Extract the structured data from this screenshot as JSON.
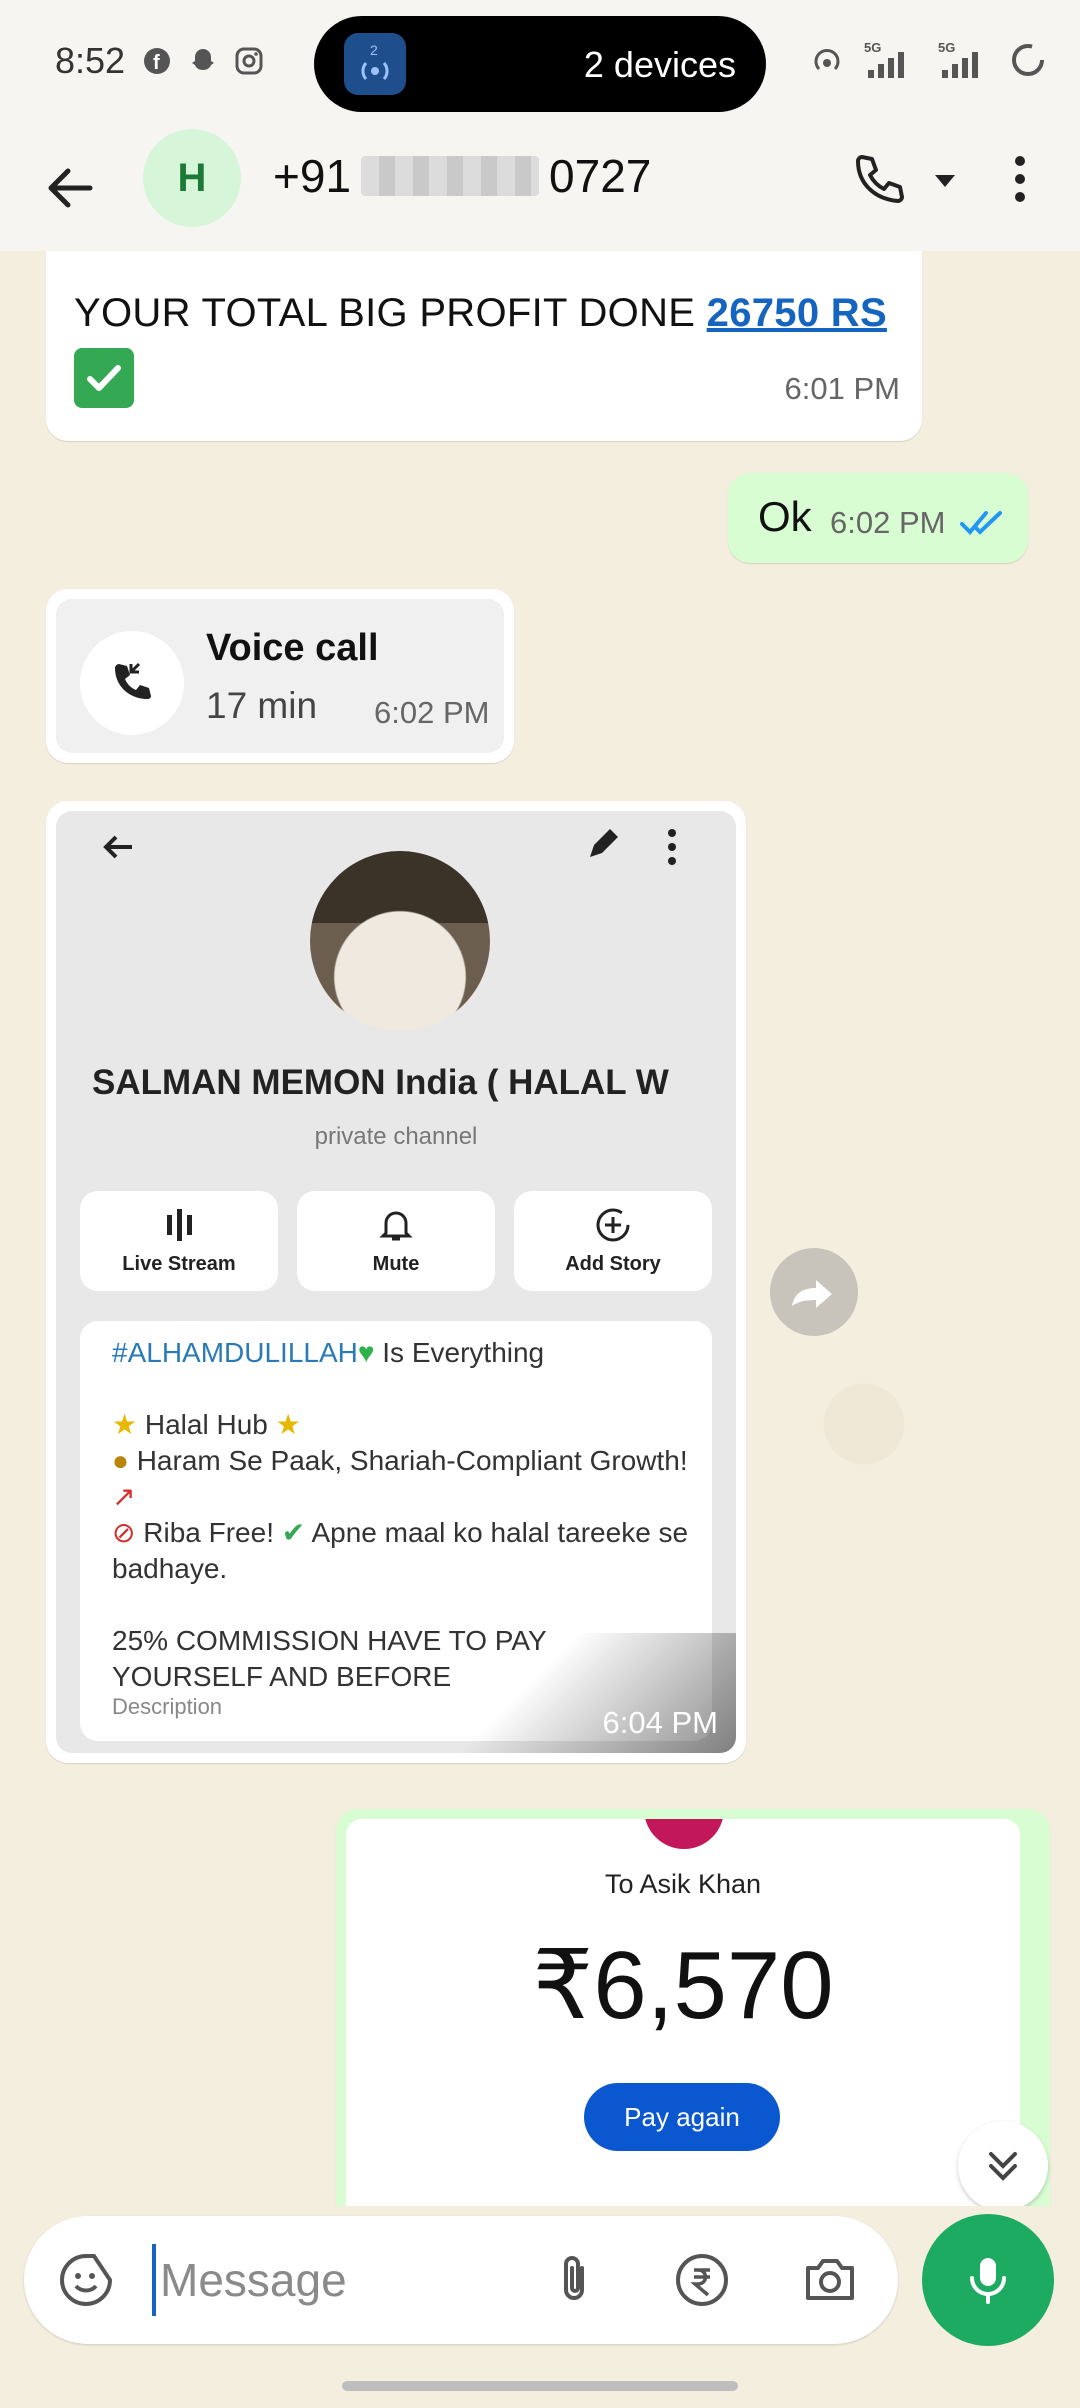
{
  "status": {
    "time": "8:52",
    "island_badge": "2",
    "island_text": "2 devices",
    "network_1": "5G",
    "network_2": "5G"
  },
  "header": {
    "avatar_initial": "H",
    "phone_prefix": "+91",
    "phone_suffix": "0727"
  },
  "messages": {
    "profit": {
      "text": "YOUR TOTAL BIG PROFIT DONE ",
      "link": "26750 RS",
      "time": "6:01 PM"
    },
    "ok": {
      "text": "Ok",
      "time": "6:02 PM"
    },
    "call": {
      "title": "Voice call",
      "duration": "17 min",
      "time": "6:02 PM"
    },
    "forwarded_image": {
      "channel_name": "SALMAN MEMON India ( HALAL W",
      "channel_sub": "private channel",
      "actions": [
        "Live Stream",
        "Mute",
        "Add Story"
      ],
      "desc_hashtag": "#ALHAMDULILLAH",
      "desc_line1_rest": " Is Everything",
      "desc_line2": "Halal  Hub",
      "desc_line3": "Haram Se Paak, Shariah-Compliant Growth!",
      "desc_line4": "Riba Free!",
      "desc_line4b": "Apne maal ko halal tareeke se badhaye.",
      "desc_line5": "25% COMMISSION HAVE TO PAY YOURSELF AND BEFORE",
      "desc_label": "Description",
      "time": "6:04 PM"
    },
    "payment": {
      "to": "To Asik Khan",
      "amount": "₹6,570",
      "button": "Pay again"
    }
  },
  "composer": {
    "placeholder": "Message"
  },
  "colors": {
    "accent_green": "#1daa61",
    "outgoing_bubble": "#d9fdd3",
    "link_blue": "#1565c0",
    "pay_button": "#0b57d0"
  }
}
